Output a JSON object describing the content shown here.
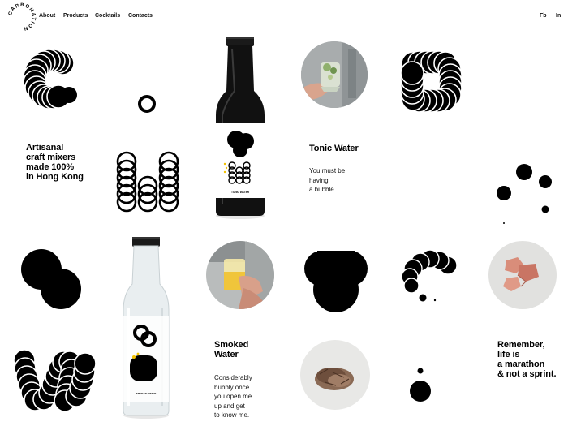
{
  "brand": {
    "logo_text": "CARBONATION"
  },
  "nav": {
    "items": [
      {
        "label": "About"
      },
      {
        "label": "Products"
      },
      {
        "label": "Cocktails"
      },
      {
        "label": "Contacts"
      }
    ],
    "social": [
      {
        "label": "Fb"
      },
      {
        "label": "In"
      }
    ]
  },
  "hero": {
    "tagline": "Artisanal\ncraft mixers\nmade 100%\nin Hong Kong"
  },
  "products": [
    {
      "name": "Tonic Water",
      "description": "You must be\nhaving\na bubble.",
      "bottle_label": "TONIC WATER",
      "bottle_color": "#111111"
    },
    {
      "name": "Smoked\nWater",
      "description": "Considerably\nbubbly once\nyou open me\nup and get\nto know me.",
      "bottle_label": "SMOKED WATER",
      "bottle_color": "#e9eef0"
    }
  ],
  "quote": {
    "text": "Remember,\nlife is\na marathon\n& not a sprint."
  },
  "colors": {
    "accent_yellow": "#f2c200",
    "ink": "#000000",
    "background": "#ffffff"
  }
}
